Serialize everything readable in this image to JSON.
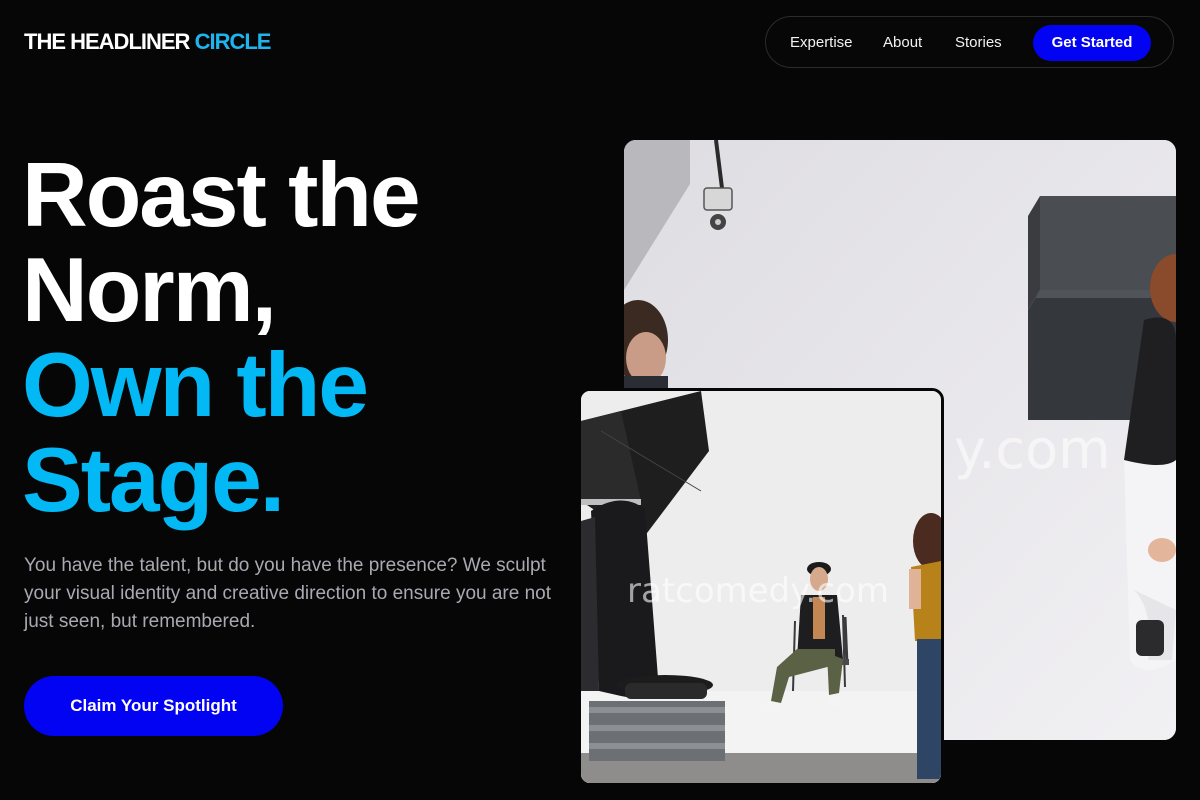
{
  "brand": {
    "name_part1": "THE HEADLINER",
    "name_part2": "CIRCLE"
  },
  "nav": {
    "links": [
      "Expertise",
      "About",
      "Stories"
    ],
    "cta_label": "Get Started"
  },
  "hero": {
    "headline_lines": [
      "Roast the",
      "Norm,",
      "Own the",
      "Stage."
    ],
    "subtext": "You have the talent, but do you have the presence? We sculpt your visual identity and creative direction to ensure you are not just seen, but remembered.",
    "cta_label": "Claim Your Spotlight"
  },
  "images": {
    "large_watermark": "y.com",
    "small_watermark": "ratcomedy.com"
  },
  "colors": {
    "background": "#060606",
    "accent_blue": "#02b8f5",
    "button_blue": "#0303f3",
    "subtext": "#a9a9b1"
  }
}
